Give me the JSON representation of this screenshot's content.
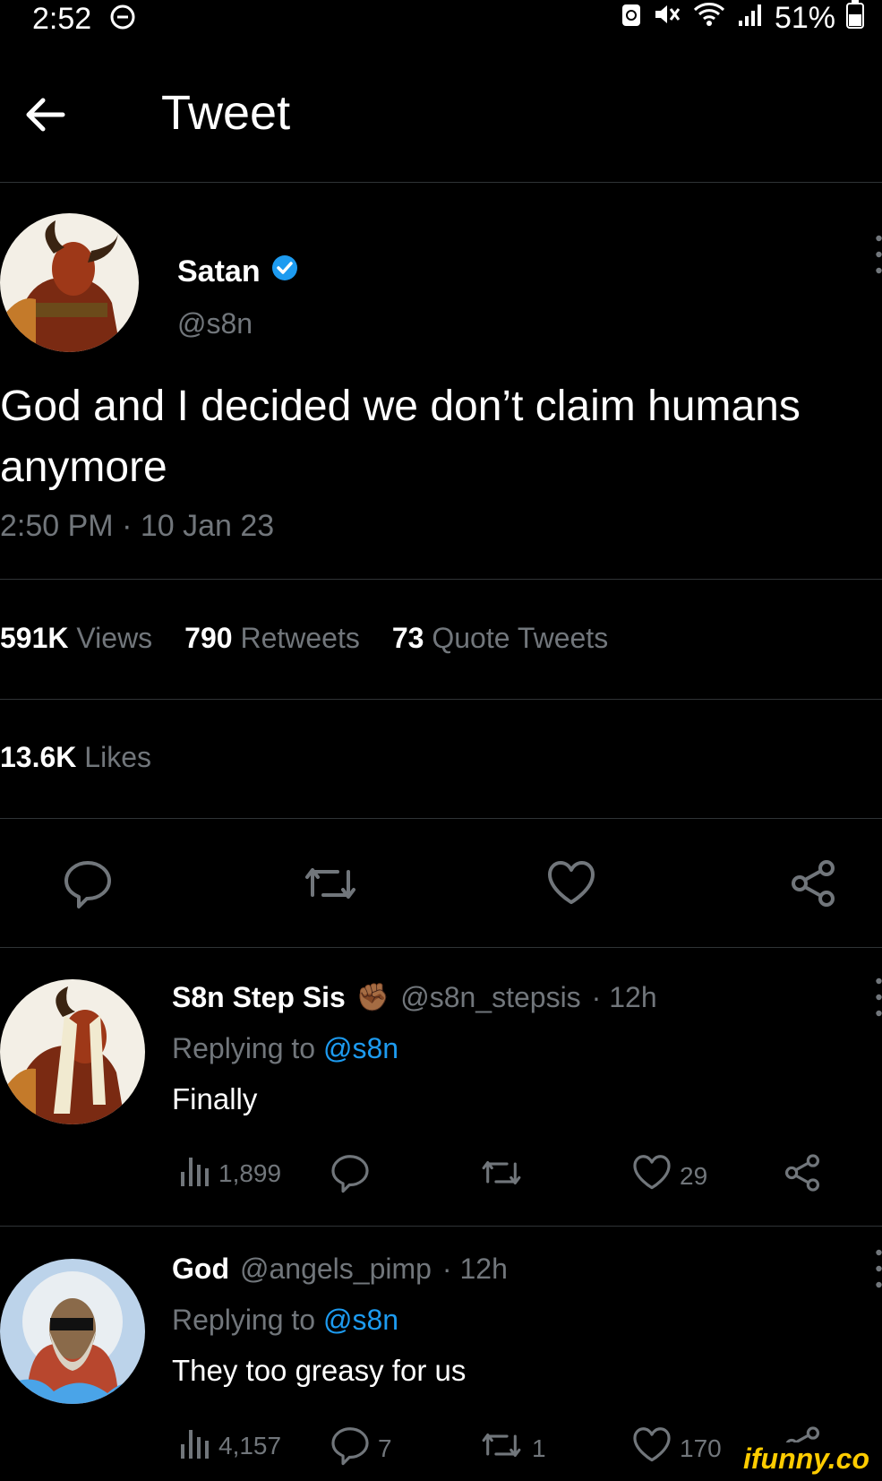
{
  "status_bar": {
    "time": "2:52",
    "battery": "51%"
  },
  "header": {
    "title": "Tweet"
  },
  "tweet": {
    "author_name": "Satan",
    "author_handle": "@s8n",
    "text": "God and I decided we don’t claim humans anymore",
    "timestamp": "2:50 PM · 10 Jan 23",
    "views_count": "591K",
    "views_label": "Views",
    "retweets_count": "790",
    "retweets_label": "Retweets",
    "quotes_count": "73",
    "quotes_label": "Quote Tweets",
    "likes_count": "13.6K",
    "likes_label": "Likes"
  },
  "replies": [
    {
      "name": "S8n Step Sis",
      "emoji": "✊🏾",
      "handle": "@s8n_stepsis",
      "age": "· 12h",
      "replying_label": "Replying to",
      "replying_to": "@s8n",
      "text": "Finally",
      "views": "1,899",
      "replies": "",
      "retweets": "",
      "likes": "29"
    },
    {
      "name": "God",
      "emoji": "",
      "handle": "@angels_pimp",
      "age": "· 12h",
      "replying_label": "Replying to",
      "replying_to": "@s8n",
      "text": "They too greasy for us",
      "views": "4,157",
      "replies": "7",
      "retweets": "1",
      "likes": "170"
    }
  ],
  "watermark": "ifunny.co",
  "colors": {
    "background": "#000000",
    "text": "#e7e9ea",
    "muted": "#71767b",
    "accent": "#1d9bf0",
    "verified": "#1d9bf0"
  }
}
